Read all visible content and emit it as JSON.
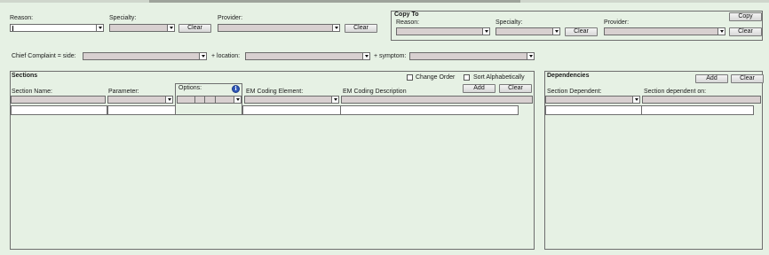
{
  "filter_bar": {
    "reason_label": "Reason:",
    "specialty_label": "Specialty:",
    "provider_label": "Provider:",
    "clear_label": "Clear",
    "clear2_label": "Clear"
  },
  "copy_to": {
    "title": "Copy To",
    "reason_label": "Reason:",
    "specialty_label": "Specialty:",
    "provider_label": "Provider:",
    "copy_label": "Copy",
    "clear_label": "Clear",
    "clear2_label": "Clear"
  },
  "complaint": {
    "prefix": "Chief Complaint = side:",
    "location_label": "+ location:",
    "symptom_label": "+ symptom:"
  },
  "sections": {
    "title": "Sections",
    "change_order_label": "Change Order",
    "sort_alpha_label": "Sort Alphabetically",
    "add_label": "Add",
    "clear_label": "Clear",
    "col_section_name": "Section Name:",
    "col_parameter": "Parameter:",
    "col_options": "Options:",
    "col_em_coding_element": "EM Coding Element:",
    "col_em_coding_description": "EM Coding Description",
    "info_glyph": "i"
  },
  "dependencies": {
    "title": "Dependencies",
    "add_label": "Add",
    "clear_label": "Clear",
    "col_section_dependent": "Section Dependent:",
    "col_section_dependent_on": "Section dependent on:"
  },
  "icons": {
    "dropdown": "chevron-down-icon",
    "info": "info-icon"
  }
}
